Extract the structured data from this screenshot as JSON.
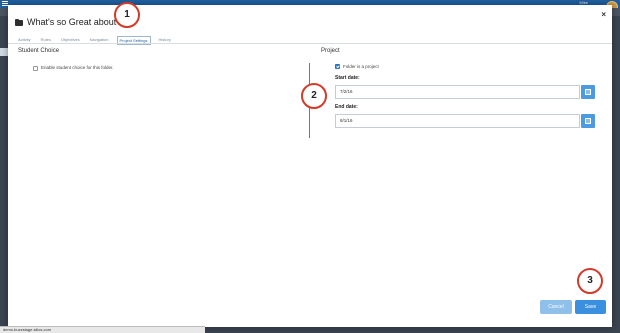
{
  "app": {
    "top_user": "Mike",
    "status_url": "demo.buzzstage.sillos.com"
  },
  "modal": {
    "title": "What's so Great about A",
    "close_label": "×",
    "tabs": [
      {
        "label": "Activity",
        "active": false
      },
      {
        "label": "Rules",
        "active": false
      },
      {
        "label": "Objectives",
        "active": false
      },
      {
        "label": "Navigation",
        "active": false
      },
      {
        "label": "Project Settings",
        "active": true
      },
      {
        "label": "History",
        "active": false
      }
    ]
  },
  "student_choice": {
    "heading": "Student Choice",
    "checkbox_label": "Enable student choice for this folder.",
    "checked": false
  },
  "project": {
    "heading": "Project",
    "checkbox_label": "Folder is a project",
    "checked": true,
    "start_label": "Start date:",
    "start_value": "7/2/16",
    "end_label": "End date:",
    "end_value": "8/1/16"
  },
  "footer": {
    "cancel_label": "Cancel",
    "save_label": "Save"
  },
  "callouts": [
    "1",
    "2",
    "3"
  ],
  "colors": {
    "accent": "#3a8fdf",
    "callout_border": "#d23b2a",
    "topbar": "#1f5fa0"
  }
}
